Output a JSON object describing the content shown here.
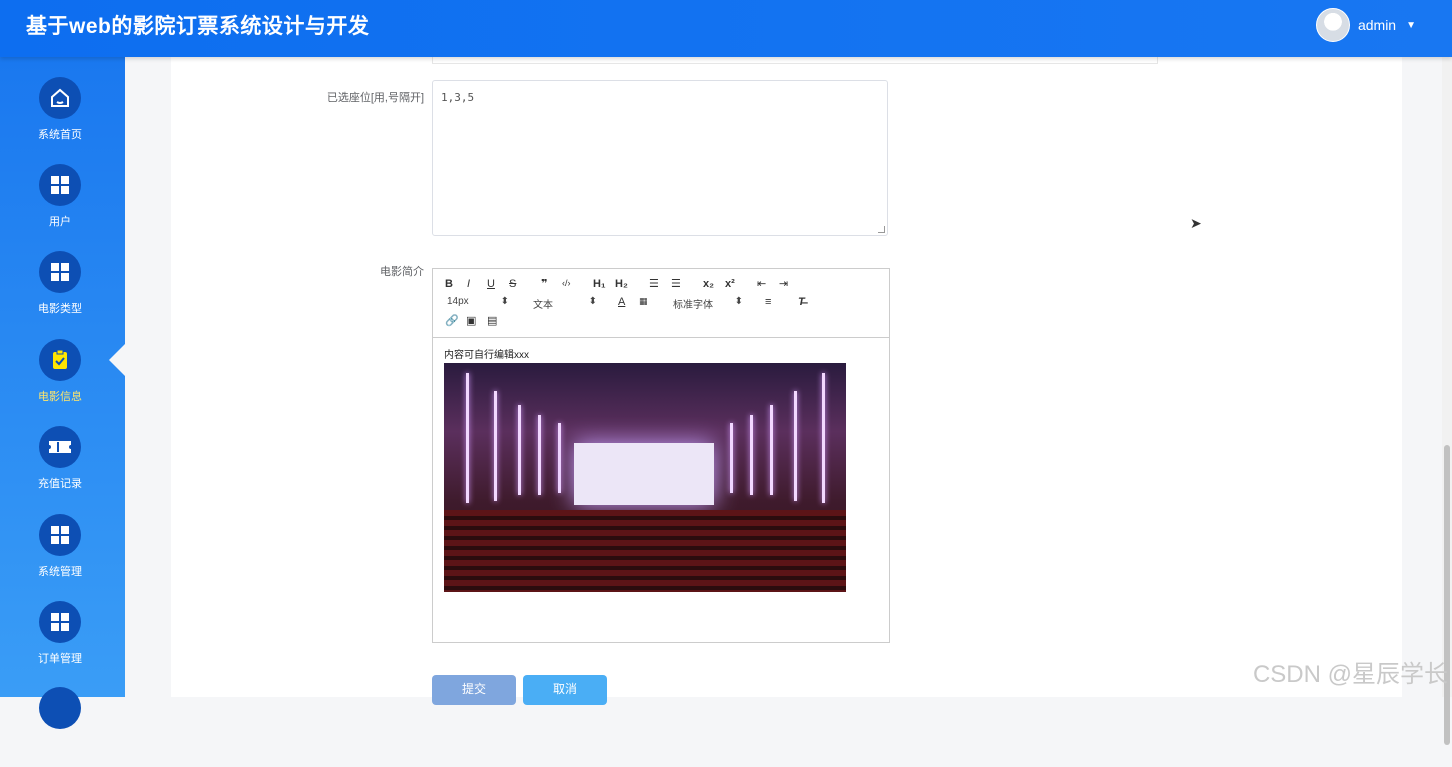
{
  "header": {
    "title": "基于web的影院订票系统设计与开发",
    "user": "admin"
  },
  "sidebar": {
    "items": [
      {
        "label": "系统首页",
        "icon": "home-icon"
      },
      {
        "label": "用户",
        "icon": "grid-icon"
      },
      {
        "label": "电影类型",
        "icon": "grid-icon"
      },
      {
        "label": "电影信息",
        "icon": "clipboard-check-icon",
        "active": true
      },
      {
        "label": "充值记录",
        "icon": "ticket-icon"
      },
      {
        "label": "系统管理",
        "icon": "grid-icon"
      },
      {
        "label": "订单管理",
        "icon": "grid-icon"
      }
    ]
  },
  "form": {
    "seats_label": "已选座位[用,号隔开]",
    "seats_value": "1,3,5",
    "intro_label": "电影简介",
    "editor": {
      "font_size": "14px",
      "format": "文本",
      "font_family": "标准字体",
      "text": "内容可自行编辑xxx"
    },
    "submit": "提交",
    "cancel": "取消"
  },
  "watermark": "CSDN @星辰学长",
  "colors": {
    "header": "#1877f2",
    "sidebar_top": "#1a78ef",
    "sidebar_bottom": "#3a9df6",
    "active": "#ffe66b"
  }
}
